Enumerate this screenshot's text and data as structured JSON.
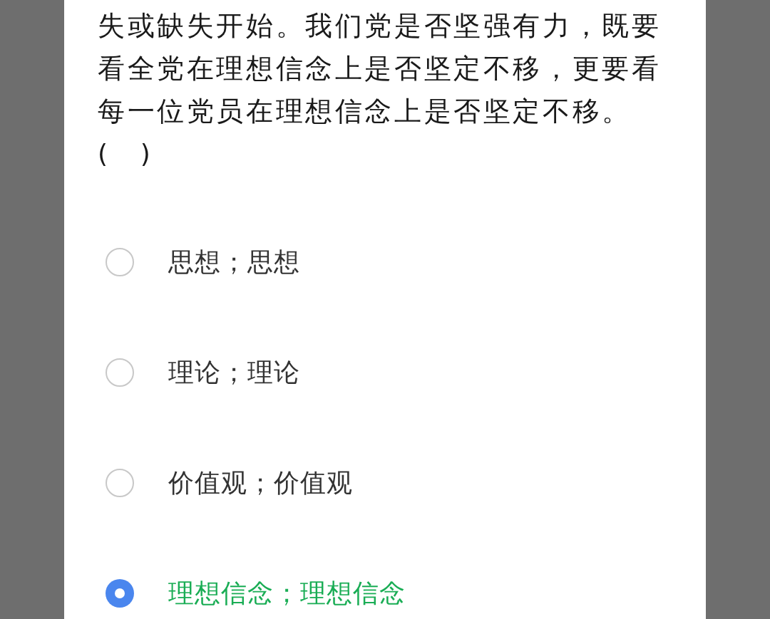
{
  "question": {
    "text": "失或缺失开始。我们党是否坚强有力，既要看全党在理想信念上是否坚定不移，更要看每一位党员在理想信念上是否坚定不移。",
    "blank": "(    )"
  },
  "options": [
    {
      "label": "思想；思想",
      "selected": false
    },
    {
      "label": "理论；理论",
      "selected": false
    },
    {
      "label": "价值观；价值观",
      "selected": false
    },
    {
      "label": "理想信念；理想信念",
      "selected": true
    }
  ]
}
